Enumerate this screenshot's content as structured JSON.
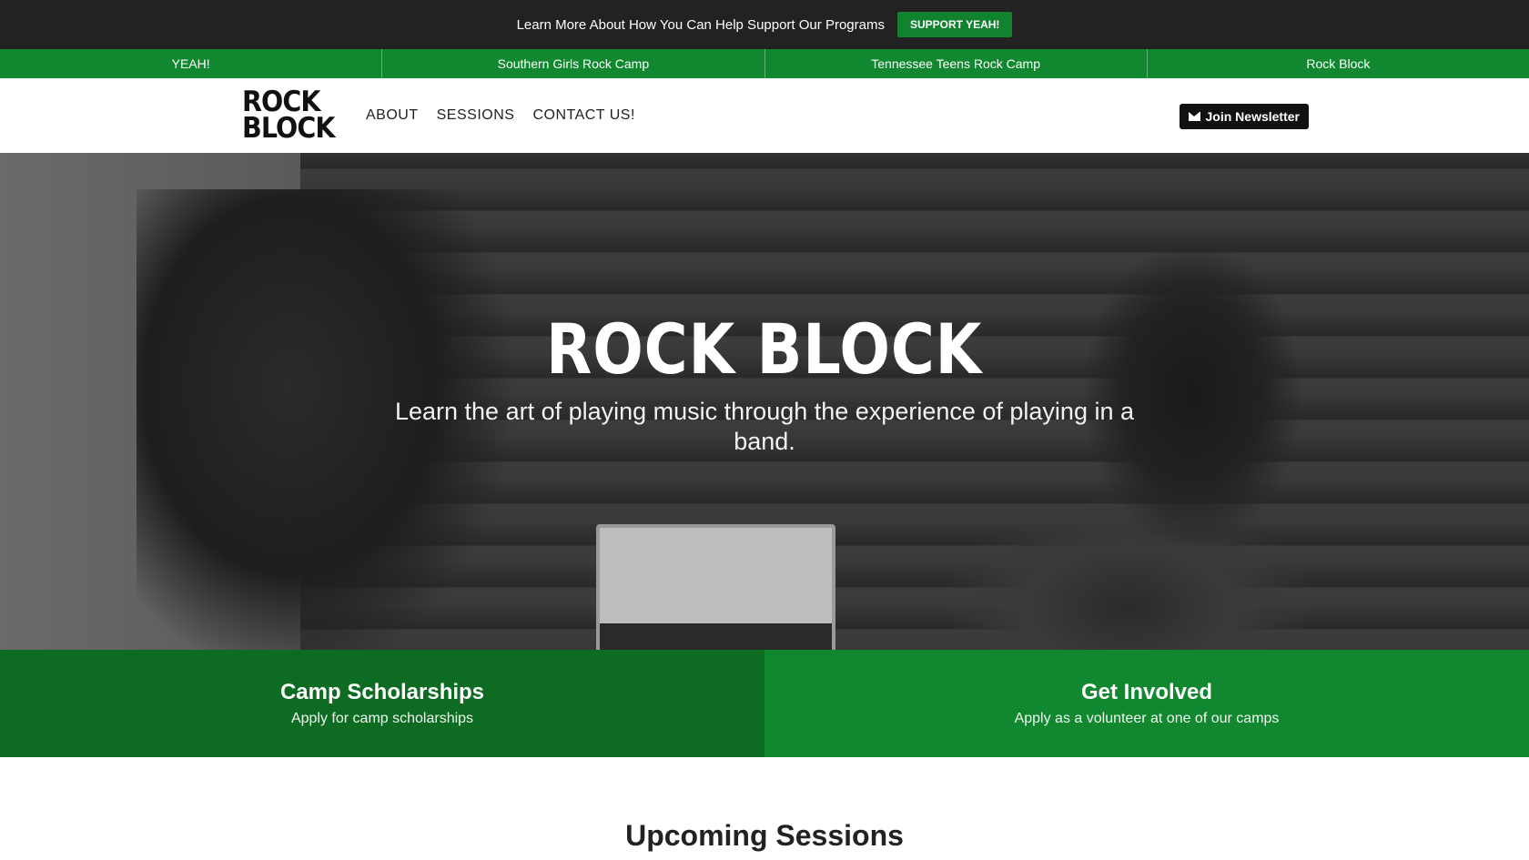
{
  "topbar": {
    "message": "Learn More About How You Can Help Support Our Programs",
    "button_label": "SUPPORT YEAH!"
  },
  "site_tabs": [
    {
      "label": "YEAH!"
    },
    {
      "label": "Southern Girls Rock Camp"
    },
    {
      "label": "Tennessee Teens Rock Camp"
    },
    {
      "label": "Rock Block"
    }
  ],
  "header": {
    "logo_line1": "ROCK",
    "logo_line2": "BLOCK",
    "nav": [
      "ABOUT",
      "SESSIONS",
      "CONTACT US!"
    ],
    "newsletter_label": "Join Newsletter",
    "newsletter_icon": "envelope-icon"
  },
  "hero": {
    "title": "ROCK BLOCK",
    "subtitle": "Learn the art of playing music through the experience of playing in a band."
  },
  "cta": [
    {
      "title": "Camp Scholarships",
      "desc": "Apply for camp scholarships"
    },
    {
      "title": "Get Involved",
      "desc": "Apply as a volunteer at one of our camps"
    }
  ],
  "upcoming_title": "Upcoming Sessions",
  "colors": {
    "brand_green": "#11882f",
    "dark_green": "#0d6b22",
    "topbar_bg": "#222222"
  }
}
